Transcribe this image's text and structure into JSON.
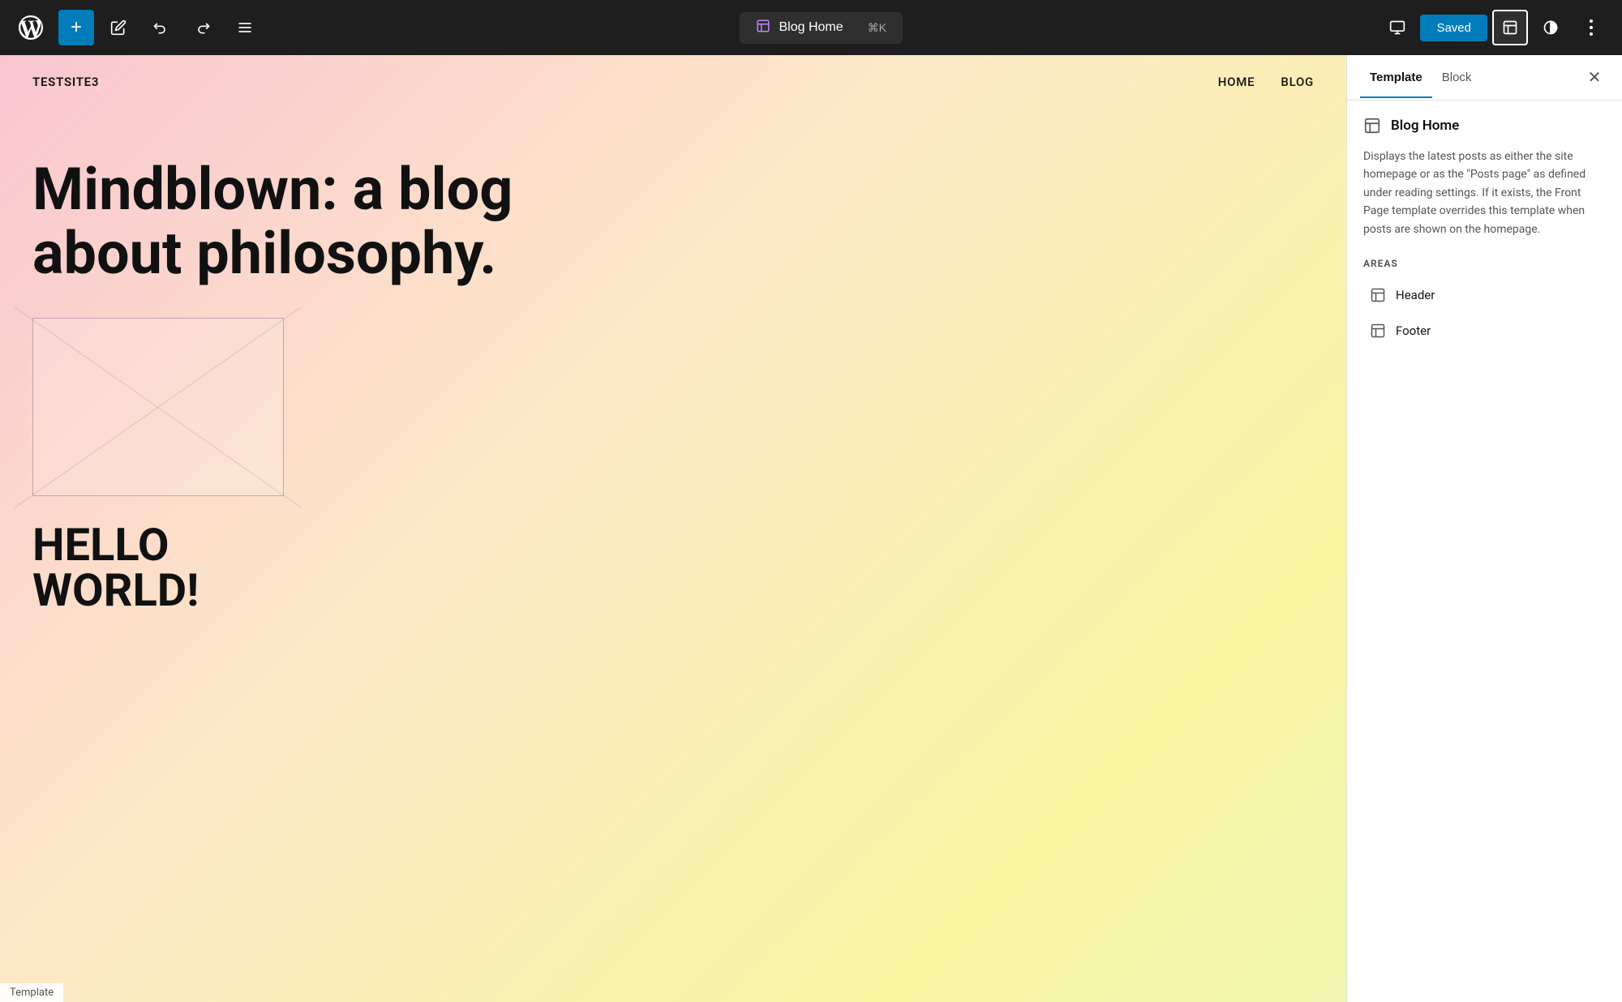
{
  "toolbar": {
    "add_label": "+",
    "undo_label": "↩",
    "redo_label": "↪",
    "list_label": "☰",
    "center": {
      "icon": "⊞",
      "text": "Blog Home",
      "shortcut": "⌘K"
    },
    "saved_label": "Saved",
    "view_icon": "□",
    "contrast_icon": "◑",
    "more_icon": "⋮"
  },
  "canvas": {
    "site_name": "TESTSITE3",
    "nav": [
      "HOME",
      "BLOG"
    ],
    "tagline": "Mindblown: a blog about philosophy.",
    "hello": "HELLO\nWORLD!"
  },
  "bottom_label": "Template",
  "panel": {
    "tabs": [
      "Template",
      "Block"
    ],
    "active_tab": "Template",
    "close_icon": "✕",
    "template": {
      "icon": "⊞",
      "title": "Blog Home",
      "description": "Displays the latest posts as either the site homepage or as the \"Posts page\" as defined under reading settings. If it exists, the Front Page template overrides this template when posts are shown on the homepage.",
      "areas_label": "AREAS",
      "areas": [
        {
          "icon": "⊞",
          "label": "Header"
        },
        {
          "icon": "⊞",
          "label": "Footer"
        }
      ]
    }
  }
}
